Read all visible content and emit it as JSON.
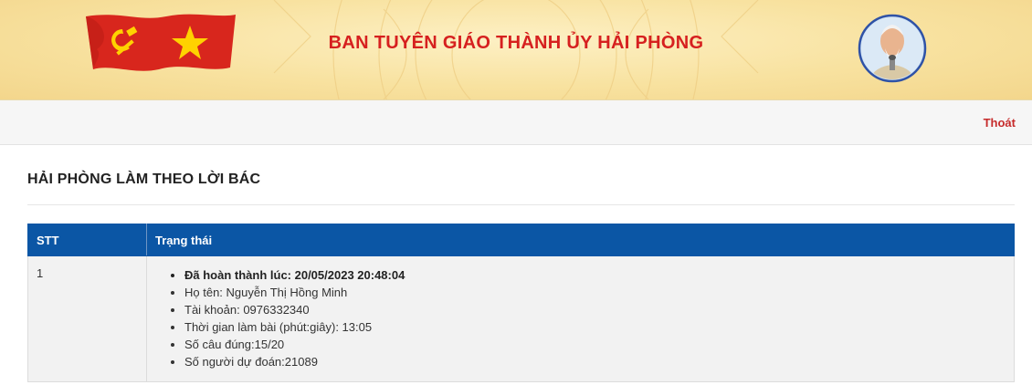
{
  "header": {
    "site_title": "BAN TUYÊN GIÁO THÀNH ỦY HẢI PHÒNG",
    "colors": {
      "title": "#d6201f",
      "flag_red": "#d8261d",
      "flag_yellow": "#ffd200"
    },
    "icons": [
      "party-flag-icon",
      "portrait-emblem-icon"
    ]
  },
  "topbar": {
    "logout_label": "Thoát"
  },
  "page": {
    "heading": "HẢI PHÒNG LÀM THEO LỜI BÁC"
  },
  "table": {
    "headers": {
      "stt": "STT",
      "status": "Trạng thái"
    },
    "header_color": "#0b56a5",
    "rows": [
      {
        "stt": "1",
        "status_items": [
          "Đã hoàn thành lúc: 20/05/2023 20:48:04",
          "Họ tên: Nguyễn Thị Hồng Minh",
          "Tài khoản: 0976332340",
          "Thời gian làm bài (phút:giây): 13:05",
          "Số câu đúng:15/20",
          "Số người dự đoán:21089"
        ]
      }
    ]
  }
}
